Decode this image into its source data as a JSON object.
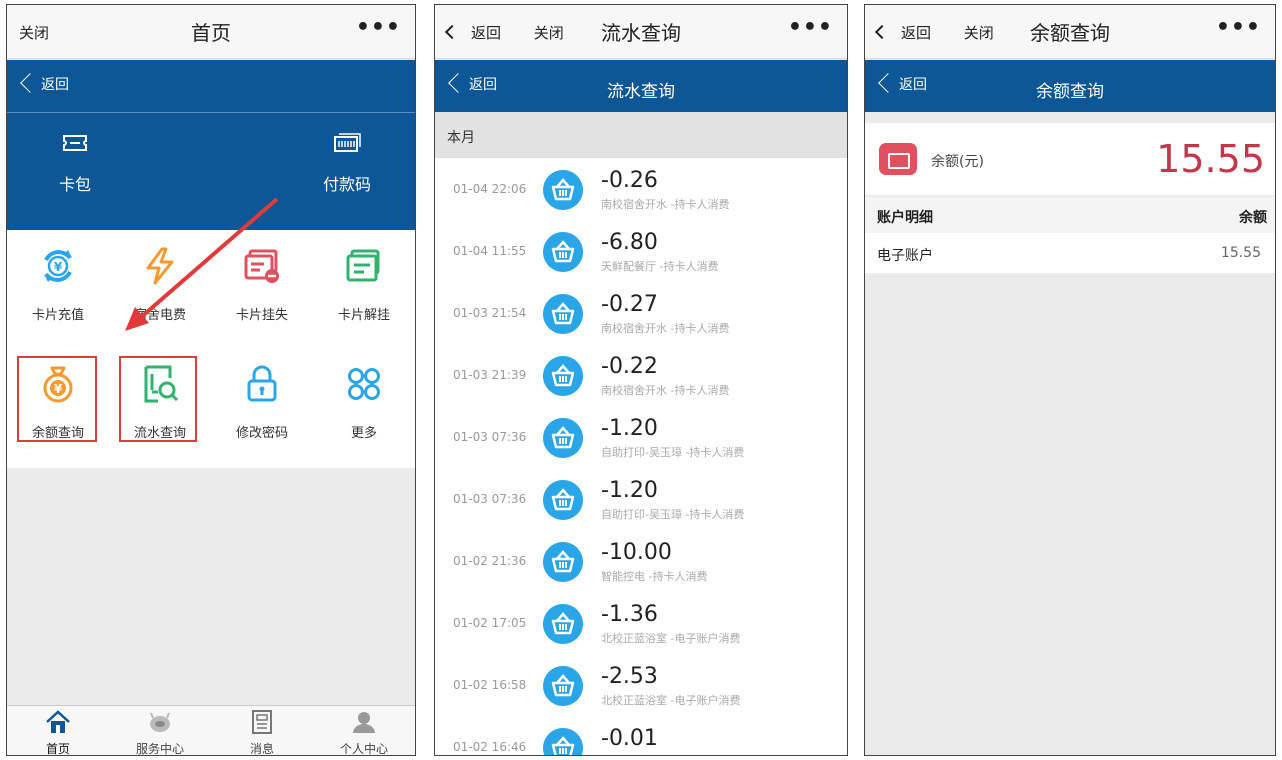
{
  "panels": [
    {
      "topbar": {
        "close": "关闭",
        "title": "首页",
        "more": "•••"
      },
      "nav": {
        "back": "返回"
      },
      "quick": [
        {
          "label": "卡包",
          "icon": "ticket-icon"
        },
        {
          "label": "付款码",
          "icon": "barcode-icon"
        }
      ],
      "grid": [
        {
          "label": "卡片充值",
          "icon": "recharge-icon",
          "color": "#2aa6e8"
        },
        {
          "label": "宿舍电费",
          "icon": "lightning-icon",
          "color": "#f29a2e"
        },
        {
          "label": "卡片挂失",
          "icon": "card-lost-icon",
          "color": "#e0505e"
        },
        {
          "label": "卡片解挂",
          "icon": "card-unlock-icon",
          "color": "#2fb36e"
        },
        {
          "label": "余额查询",
          "icon": "money-bag-icon",
          "color": "#f29a2e"
        },
        {
          "label": "流水查询",
          "icon": "statement-search-icon",
          "color": "#2fb36e"
        },
        {
          "label": "修改密码",
          "icon": "lock-icon",
          "color": "#2aa6e8"
        },
        {
          "label": "更多",
          "icon": "more-grid-icon",
          "color": "#2aa6e8"
        }
      ],
      "tabs": [
        {
          "label": "首页",
          "icon": "home-icon"
        },
        {
          "label": "服务中心",
          "icon": "service-icon"
        },
        {
          "label": "消息",
          "icon": "news-icon"
        },
        {
          "label": "个人中心",
          "icon": "user-icon"
        }
      ]
    },
    {
      "topbar": {
        "back": "返回",
        "close": "关闭",
        "title": "流水查询",
        "more": "•••"
      },
      "nav": {
        "back": "返回",
        "title": "流水查询"
      },
      "section": "本月",
      "transactions": [
        {
          "time": "01-04 22:06",
          "amount": "-0.26",
          "desc": "南校宿舍开水 -持卡人消费"
        },
        {
          "time": "01-04 11:55",
          "amount": "-6.80",
          "desc": "天鲜配餐厅 -持卡人消费"
        },
        {
          "time": "01-03 21:54",
          "amount": "-0.27",
          "desc": "南校宿舍开水 -持卡人消费"
        },
        {
          "time": "01-03 21:39",
          "amount": "-0.22",
          "desc": "南校宿舍开水 -持卡人消费"
        },
        {
          "time": "01-03 07:36",
          "amount": "-1.20",
          "desc": "自助打印-吴玉璋 -持卡人消费"
        },
        {
          "time": "01-03 07:36",
          "amount": "-1.20",
          "desc": "自助打印-吴玉璋 -持卡人消费"
        },
        {
          "time": "01-02 21:36",
          "amount": "-10.00",
          "desc": "智能控电 -持卡人消费"
        },
        {
          "time": "01-02 17:05",
          "amount": "-1.36",
          "desc": "北校正蓝浴室 -电子账户消费"
        },
        {
          "time": "01-02 16:58",
          "amount": "-2.53",
          "desc": "北校正蓝浴室 -电子账户消费"
        },
        {
          "time": "01-02 16:46",
          "amount": "-0.01",
          "desc": ""
        }
      ]
    },
    {
      "topbar": {
        "back": "返回",
        "close": "关闭",
        "title": "余额查询",
        "more": "•••"
      },
      "nav": {
        "back": "返回",
        "title": "余额查询"
      },
      "balance": {
        "label": "余额(元)",
        "value": "15.55"
      },
      "detail_header": {
        "left": "账户明细",
        "right": "余额"
      },
      "detail_rows": [
        {
          "name": "电子账户",
          "value": "15.55"
        }
      ]
    }
  ]
}
